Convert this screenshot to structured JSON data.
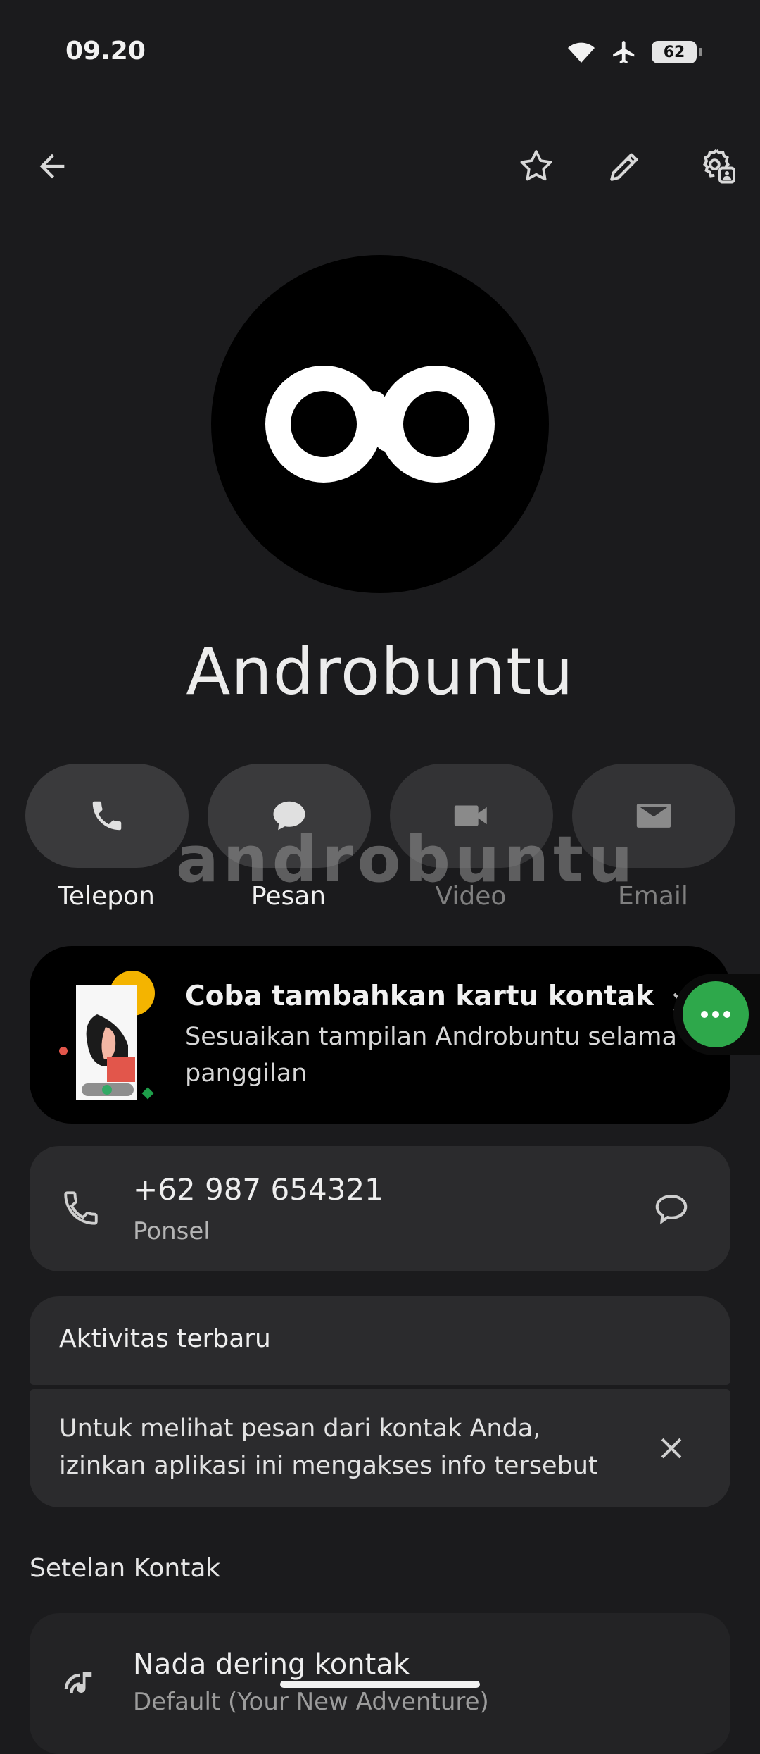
{
  "status_bar": {
    "time": "09.20",
    "battery": "62"
  },
  "contact": {
    "name": "Androbuntu"
  },
  "actions": [
    {
      "label": "Telepon",
      "icon": "phone-icon",
      "enabled": true
    },
    {
      "label": "Pesan",
      "icon": "message-icon",
      "enabled": true
    },
    {
      "label": "Video",
      "icon": "video-icon",
      "enabled": false
    },
    {
      "label": "Email",
      "icon": "email-icon",
      "enabled": false
    }
  ],
  "watermark": "androbuntu",
  "promo": {
    "title": "Coba tambahkan kartu kontak",
    "description": "Sesuaikan tampilan Androbuntu selama panggilan"
  },
  "phone": {
    "number": "+62 987 654321",
    "type": "Ponsel"
  },
  "activity": {
    "title": "Aktivitas terbaru",
    "message": "Untuk melihat pesan dari kontak Anda, izinkan aplikasi ini mengakses info tersebut"
  },
  "settings": {
    "title": "Setelan Kontak",
    "ringtone_title": "Nada dering kontak",
    "ringtone_value": "Default (Your New Adventure)"
  },
  "colors": {
    "background": "#1b1b1d",
    "card": "#2b2b2d",
    "fab": "#2ea84b",
    "promo_accent": "#f4b400"
  }
}
